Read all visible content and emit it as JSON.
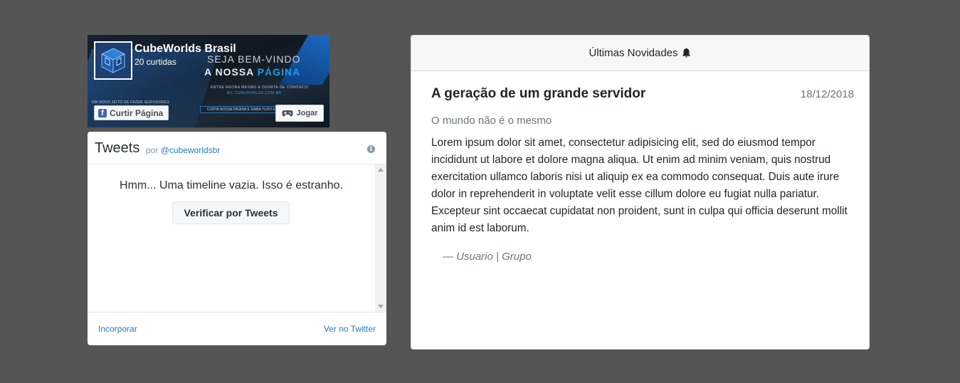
{
  "facebook": {
    "page_name": "CubeWorlds Brasil",
    "likes": "20 curtidas",
    "cover": {
      "welcome_line1": "SEJA BEM-VINDO",
      "welcome_line2_prefix": "A NOSSA ",
      "welcome_line2_highlight": "PÁGINA",
      "invite": "ENTRE AGORA MESMO E DIVIRTA-SE CONOSCO!",
      "server_address": "MC.CUBEWORLDS.COM.BR",
      "tagline": "UM NOVO JEITO DE FAZER SERVIDORES",
      "banner": "CURTA NOSSA PÁGINA E SAIBA TUDO EM",
      "highlight_color": "#1e9be8"
    },
    "like_button": "Curtir Página",
    "play_button": "Jogar"
  },
  "twitter": {
    "title": "Tweets",
    "by_prefix": "por",
    "handle": "@cubeworldsbr",
    "empty_message": "Hmm... Uma timeline vazia. Isso é estranho.",
    "check_button": "Verificar por Tweets",
    "embed_link": "Incorporar",
    "view_link": "Ver no Twitter",
    "link_color": "#2b7bb9"
  },
  "news": {
    "header": "Últimas Novidades",
    "header_icon": "bell-icon",
    "title": "A geração de um grande servidor",
    "date": "18/12/2018",
    "subtitle": "O mundo não é o mesmo",
    "body": "Lorem ipsum dolor sit amet, consectetur adipisicing elit, sed do eiusmod tempor incididunt ut labore et dolore magna aliqua. Ut enim ad minim veniam, quis nostrud exercitation ullamco laboris nisi ut aliquip ex ea commodo consequat. Duis aute irure dolor in reprehenderit in voluptate velit esse cillum dolore eu fugiat nulla pariatur. Excepteur sint occaecat cupidatat non proident, sunt in culpa qui officia deserunt mollit anim id est laborum.",
    "footer": "— Usuario | Grupo"
  },
  "colors": {
    "page_background": "#555555",
    "facebook_blue": "#4267b2"
  }
}
